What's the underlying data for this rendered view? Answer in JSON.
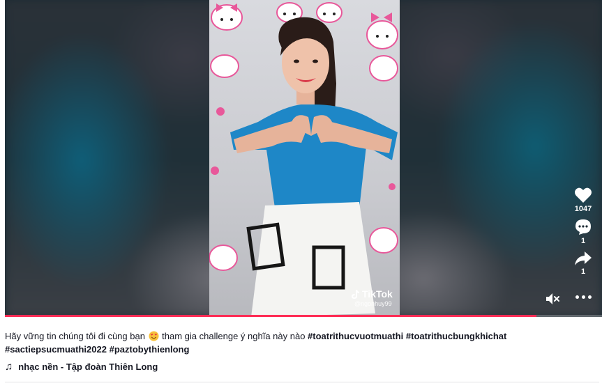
{
  "video": {
    "watermark_logo": "TikTok",
    "watermark_user": "@ngonhuy99",
    "progress": 0.89
  },
  "actions": {
    "like": {
      "icon": "heart-icon",
      "count": "1047"
    },
    "comment": {
      "icon": "comment-icon",
      "count": "1"
    },
    "share": {
      "icon": "share-icon",
      "count": "1"
    },
    "mute_icon": "muted-speaker-icon",
    "more_icon": "more-options-icon"
  },
  "caption": {
    "text_before": "Hãy vững tin chúng tôi đi cùng bạn ",
    "emoji": "smiling-face-with-hearts",
    "text_after": " tham gia challenge ý nghĩa này nào ",
    "hashtags": [
      "#toatrithucvuotmuathi",
      "#toatrithucbungkhichat",
      "#sactiepsucmuathi2022",
      "#paztobythienlong"
    ]
  },
  "music": {
    "icon": "music-note-icon",
    "label": "nhạc nền - Tập đoàn Thiên Long"
  },
  "colors": {
    "accent": "#fe2c55",
    "text": "#161823"
  }
}
